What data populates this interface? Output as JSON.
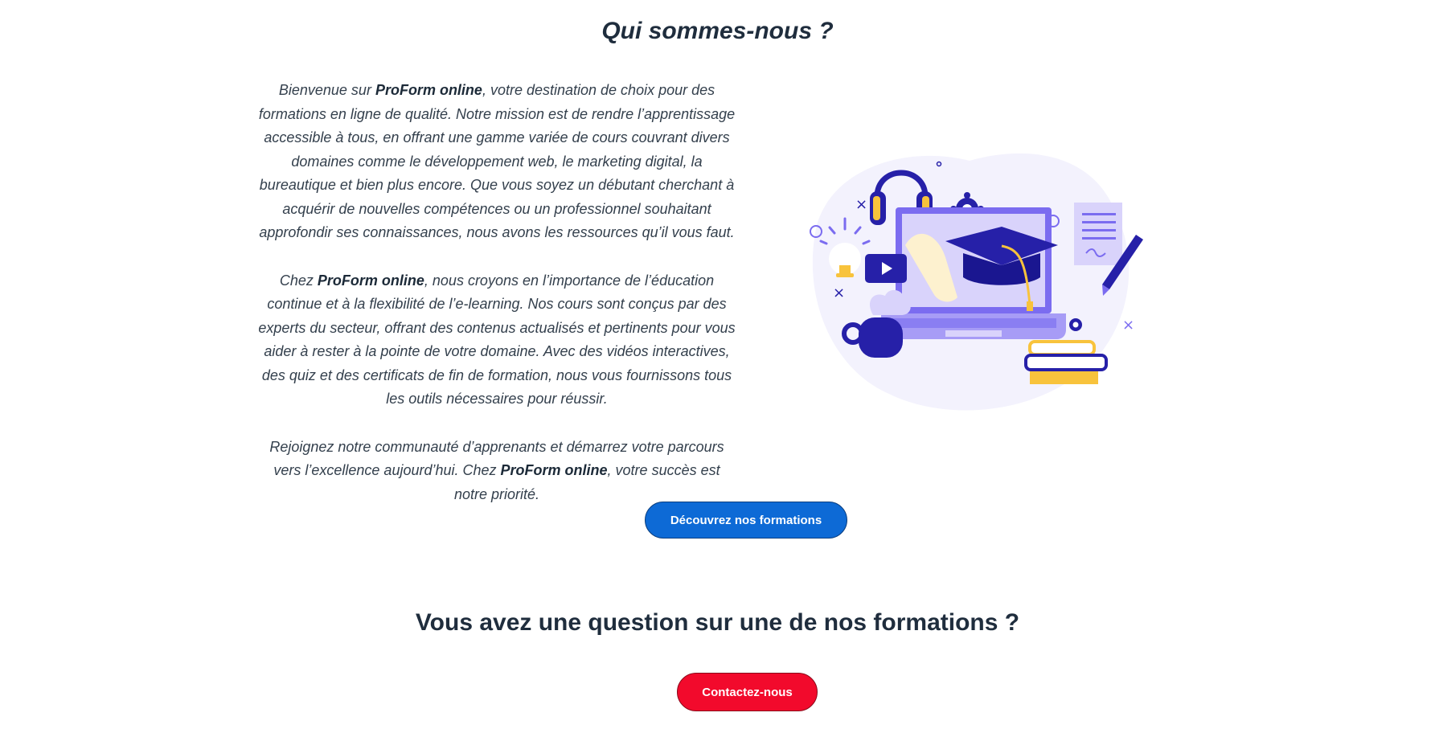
{
  "about": {
    "title": "Qui sommes-nous ?",
    "brand": "ProForm online",
    "p1_pre": "Bienvenue sur ",
    "p1_post": ", votre destination de choix pour des formations en ligne de qualité. Notre mission est de rendre l’apprentissage accessible à tous, en offrant une gamme variée de cours couvrant divers domaines comme le développement web, le marketing digital, la bureautique et bien plus encore. Que vous soyez un débutant cherchant à acquérir de nouvelles compétences ou un professionnel souhaitant approfondir ses connaissances, nous avons les ressources qu’il vous faut.",
    "p2_pre": "Chez ",
    "p2_post": ", nous croyons en l’importance de l’éducation continue et à la flexibilité de l’e-learning. Nos cours sont conçus par des experts du secteur, offrant des contenus actualisés et pertinents pour vous aider à rester à la pointe de votre domaine. Avec des vidéos interactives, des quiz et des certificats de fin de formation, nous vous fournissons tous les outils nécessaires pour réussir.",
    "p3_pre": "Rejoignez notre communauté d’apprenants et démarrez votre parcours vers l’excellence aujourd’hui. Chez ",
    "p3_post": ", votre succès est notre priorité.",
    "cta_label": "Découvrez nos formations"
  },
  "contact": {
    "title": "Vous avez une question sur une de nos formations ?",
    "cta_label": "Contactez-nous"
  },
  "colors": {
    "primary_button": "#0d6ad6",
    "contact_button": "#f20a2c",
    "heading": "#1f2d3d",
    "illustration_purple": "#7b6cf0",
    "illustration_navy": "#2620a8",
    "illustration_yellow": "#f8c33c"
  }
}
